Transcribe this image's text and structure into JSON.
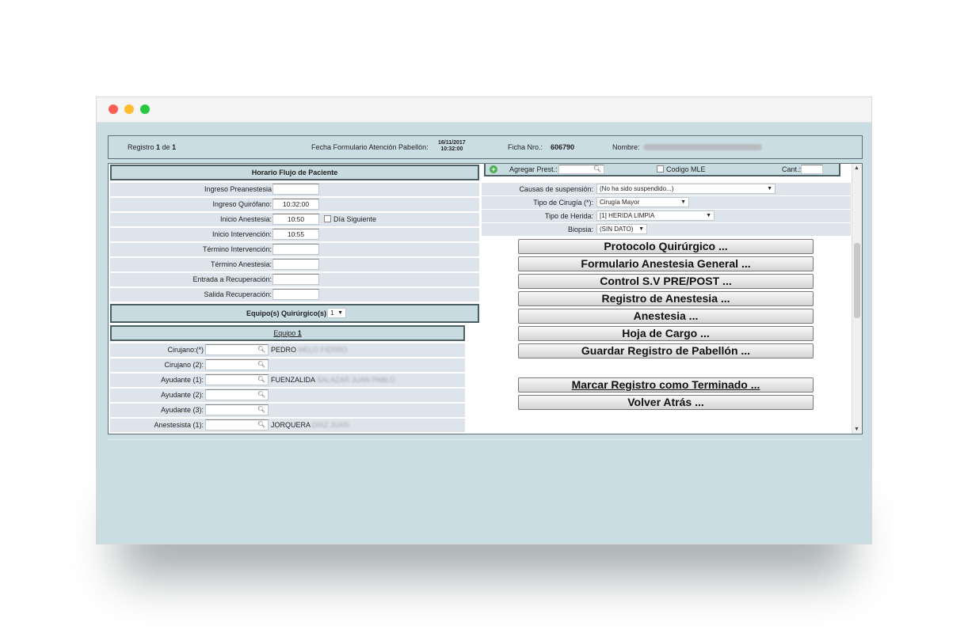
{
  "window": {
    "controls": [
      "close",
      "minimize",
      "maximize"
    ]
  },
  "header": {
    "registro_prefix": "Registro",
    "registro_num": "1",
    "registro_de": "de",
    "registro_total": "1",
    "fecha_label": "Fecha Formulario Atención Pabellón:",
    "fecha_date": "16/11/2017",
    "fecha_time": "10:32:00",
    "ficha_label": "Ficha Nro.:",
    "ficha_value": "606790",
    "nombre_label": "Nombre:"
  },
  "horario": {
    "title": "Horario Flujo de Paciente",
    "rows": [
      {
        "label": "Ingreso Preanestesia",
        "value": ""
      },
      {
        "label": "Ingreso Quirófano:",
        "value": "10:32:00"
      },
      {
        "label": "Inicio Anestesia:",
        "value": "10:50"
      },
      {
        "label": "Inicio Intervención:",
        "value": "10:55"
      },
      {
        "label": "Término Intervención:",
        "value": ""
      },
      {
        "label": "Término Anestesia:",
        "value": ""
      },
      {
        "label": "Entrada a Recuperación:",
        "value": ""
      },
      {
        "label": "Salida Recuperación:",
        "value": ""
      }
    ],
    "dia_siguiente": "Día Siguiente"
  },
  "equipos": {
    "label": "Equipo(s) Quirúrgico(s)",
    "selected": "1"
  },
  "equipo": {
    "title_prefix": "Equipo",
    "title_num": "1"
  },
  "team": [
    {
      "label": "Cirujano:(*)",
      "name": "PEDRO",
      "name_hidden": "MELO FIERRO"
    },
    {
      "label": "Cirujano (2):",
      "name": "",
      "name_hidden": ""
    },
    {
      "label": "Ayudante (1):",
      "name": "FUENZALIDA",
      "name_hidden": "SALAZAR JUAN PABLO"
    },
    {
      "label": "Ayudante (2):",
      "name": "",
      "name_hidden": ""
    },
    {
      "label": "Ayudante (3):",
      "name": "",
      "name_hidden": ""
    },
    {
      "label": "Anestesista (1):",
      "name": "JORQUERA",
      "name_hidden": "DIAZ JUAN"
    }
  ],
  "prest": {
    "agregar_label": "Agregar Prest.:",
    "codigo_mle": "Codigo MLE",
    "cant_label": "Cant.:"
  },
  "fields": [
    {
      "label": "Causas de suspensión:",
      "value": "(No ha sido suspendido...)"
    },
    {
      "label": "Tipo de Cirugía (*):",
      "value": "Cirugía Mayor"
    },
    {
      "label": "Tipo de Herida:",
      "value": "[1] HERIDA LIMPIA"
    },
    {
      "label": "Biopsia:",
      "value": "(SIN DATO)"
    }
  ],
  "buttons": [
    "Protocolo Quirúrgico ...",
    "Formulario Anestesia General ...",
    "Control S.V PRE/POST ...",
    "Registro de Anestesia ...",
    "Anestesia ...",
    "Hoja de Cargo ...",
    "Guardar Registro de Pabellón ..."
  ],
  "marcar_button": "Marcar Registro como Terminado ...",
  "volver_button": "Volver Atrás ...",
  "colors": {
    "background": "#cadde2",
    "header_border": "#4d6066",
    "row_bg": "#dde4eb"
  }
}
